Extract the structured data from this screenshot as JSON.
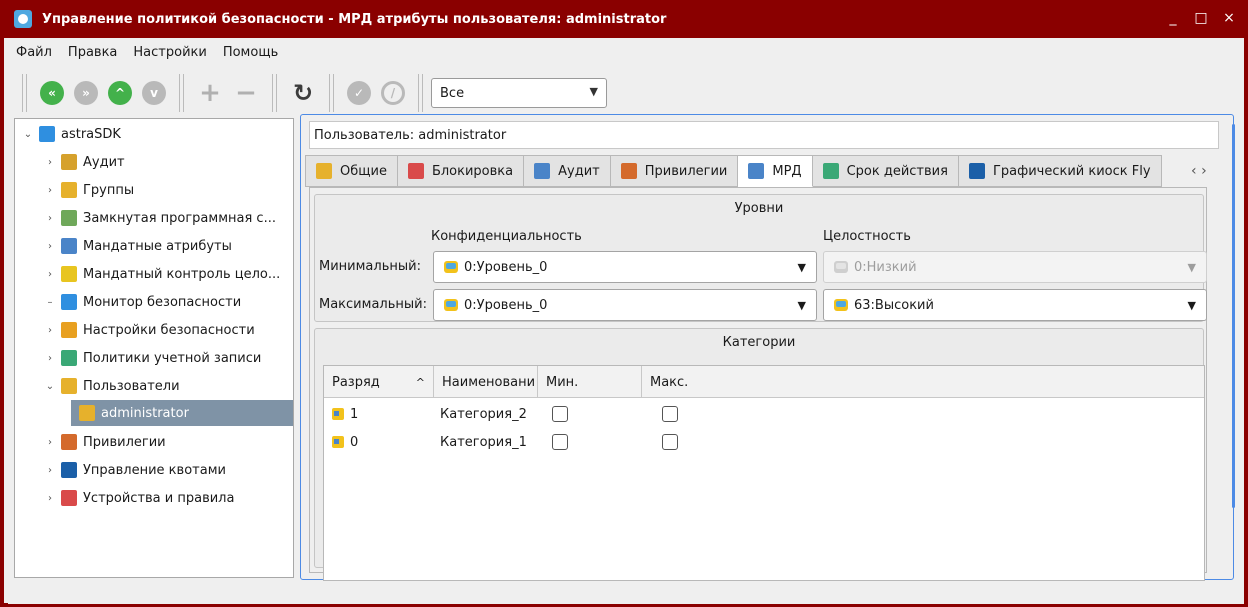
{
  "window": {
    "title": "Управление политикой безопасности - МРД атрибуты пользователя: administrator",
    "controls": [
      "_",
      "□",
      "×"
    ]
  },
  "menu": [
    "Файл",
    "Правка",
    "Настройки",
    "Помощь"
  ],
  "toolbar": {
    "filter": "Все"
  },
  "tree": [
    {
      "label": "astraSDK",
      "expanded": true,
      "icon": "monitor-icon",
      "color": "#2f8fe0"
    },
    {
      "label": "Аудит",
      "icon": "audit-icon",
      "color": "#d6a12c"
    },
    {
      "label": "Группы",
      "icon": "groups-icon",
      "color": "#e6b12c"
    },
    {
      "label": "Замкнутая программная с...",
      "icon": "closed-env-icon",
      "color": "#6fa85a"
    },
    {
      "label": "Мандатные атрибуты",
      "icon": "mandatory-attributes-icon",
      "color": "#4a84c8"
    },
    {
      "label": "Мандатный контроль цело...",
      "icon": "integrity-control-icon",
      "color": "#e8c520"
    },
    {
      "label": "Монитор безопасности",
      "icon": "security-monitor-icon",
      "color": "#2f8fe0"
    },
    {
      "label": "Настройки безопасности",
      "icon": "security-settings-icon",
      "color": "#e8a020"
    },
    {
      "label": "Политики учетной записи",
      "icon": "account-policy-icon",
      "color": "#3aa876"
    },
    {
      "label": "Пользователи",
      "expanded": true,
      "icon": "users-icon",
      "color": "#e6b12c"
    },
    {
      "label": "administrator",
      "icon": "user-icon",
      "color": "#e6b12c",
      "selected": true
    },
    {
      "label": "Привилегии",
      "icon": "privileges-icon",
      "color": "#d46a2c"
    },
    {
      "label": "Управление квотами",
      "icon": "quota-icon",
      "color": "#1b5fa8"
    },
    {
      "label": "Устройства и правила",
      "icon": "devices-icon",
      "color": "#d94a4a"
    }
  ],
  "user_field": "Пользователь: administrator",
  "tabs": [
    {
      "label": "Общие",
      "icon": "general-icon",
      "color": "#e6b12c"
    },
    {
      "label": "Блокировка",
      "icon": "lock-icon",
      "color": "#d94a4a"
    },
    {
      "label": "Аудит",
      "icon": "audit-icon",
      "color": "#4a84c8"
    },
    {
      "label": "Привилегии",
      "icon": "privileges-icon",
      "color": "#d46a2c"
    },
    {
      "label": "МРД",
      "icon": "mrd-icon",
      "color": "#4a84c8",
      "active": true
    },
    {
      "label": "Срок действия",
      "icon": "expiry-icon",
      "color": "#3aa876"
    },
    {
      "label": "Графический киоск Fly",
      "icon": "kiosk-icon",
      "color": "#1b5fa8"
    }
  ],
  "levels": {
    "title": "Уровни",
    "conf_header": "Конфиденциальность",
    "int_header": "Целостность",
    "min_label": "Минимальный:",
    "max_label": "Максимальный:",
    "min_conf": "0:Уровень_0",
    "min_int": "0:Низкий",
    "max_conf": "0:Уровень_0",
    "max_int": "63:Высокий"
  },
  "categories": {
    "title": "Категории",
    "columns": [
      "Разряд",
      "Наименовани",
      "Мин.",
      "Макс."
    ],
    "rows": [
      {
        "bit": "1",
        "name": "Категория_2",
        "min": false,
        "max": false
      },
      {
        "bit": "0",
        "name": "Категория_1",
        "min": false,
        "max": false
      }
    ]
  }
}
